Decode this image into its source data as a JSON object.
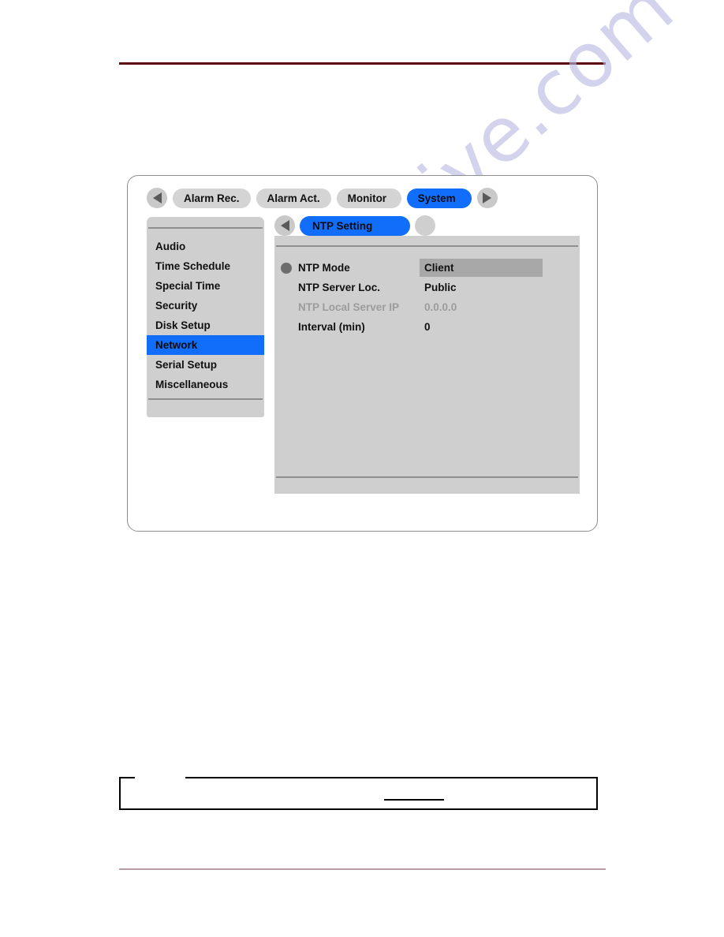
{
  "watermark": {
    "text": "manualshive.com"
  },
  "device": {
    "top_tabs": {
      "prev_arrow": "triangle-left-icon",
      "next_arrow": "triangle-right-icon",
      "items": [
        {
          "label": "Alarm Rec.",
          "active": false
        },
        {
          "label": "Alarm Act.",
          "active": false
        },
        {
          "label": "Monitor",
          "active": false
        },
        {
          "label": "System",
          "active": true
        }
      ]
    },
    "sidebar": {
      "items": [
        {
          "label": "Audio",
          "active": false
        },
        {
          "label": "Time Schedule",
          "active": false
        },
        {
          "label": "Special Time",
          "active": false
        },
        {
          "label": "Security",
          "active": false
        },
        {
          "label": "Disk Setup",
          "active": false
        },
        {
          "label": "Network",
          "active": true
        },
        {
          "label": "Serial Setup",
          "active": false
        },
        {
          "label": "Miscellaneous",
          "active": false
        }
      ]
    },
    "sub_tabs": {
      "prev_arrow": "triangle-left-icon",
      "items": [
        {
          "label": "NTP Setting",
          "active": true
        }
      ]
    },
    "settings": {
      "rows": [
        {
          "label": "NTP Mode",
          "value": "Client",
          "bullet": true,
          "dim": false,
          "selected": true
        },
        {
          "label": "NTP Server Loc.",
          "value": "Public",
          "bullet": false,
          "dim": false,
          "selected": false
        },
        {
          "label": "NTP Local Server IP",
          "value": "0.0.0.0",
          "bullet": false,
          "dim": true,
          "selected": false
        },
        {
          "label": "Interval (min)",
          "value": "0",
          "bullet": false,
          "dim": false,
          "selected": false
        }
      ]
    }
  },
  "colors": {
    "accent_blue": "#106efb",
    "panel_gray": "#cfcfcf",
    "tab_gray": "#d4d4d4",
    "selection_gray": "#a8a8a8",
    "dim_text": "#9c9c9c",
    "top_rule": "#5a0d0d",
    "bottom_rule": "#b79aa5"
  }
}
